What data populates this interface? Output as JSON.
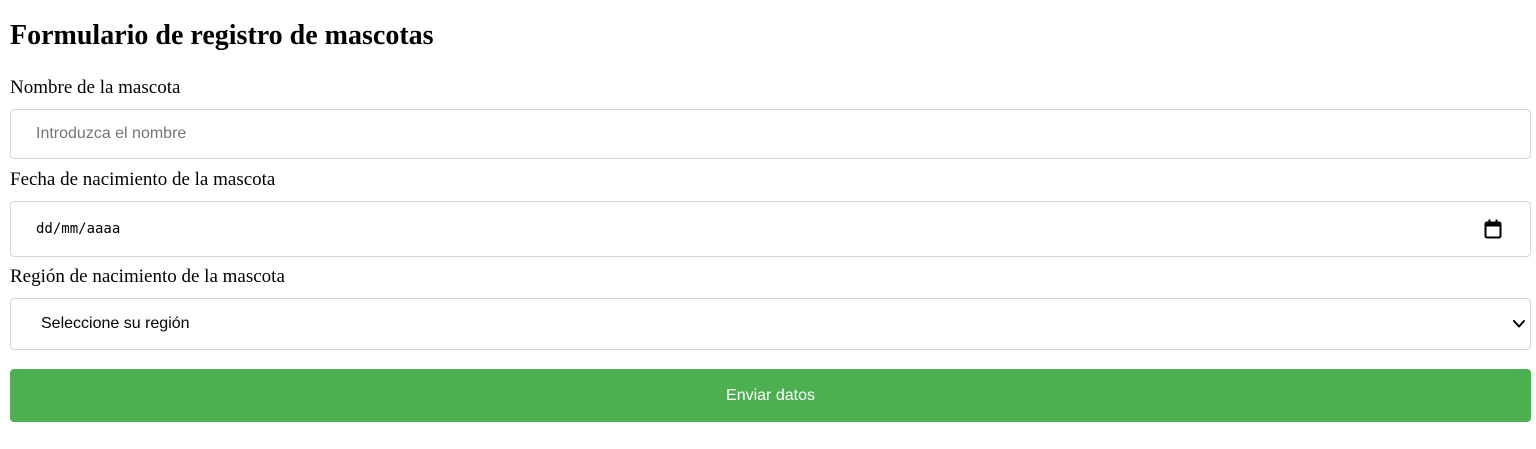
{
  "form": {
    "title": "Formulario de registro de mascotas",
    "name_field": {
      "label": "Nombre de la mascota",
      "value": "",
      "placeholder": "Introduzca el nombre"
    },
    "birthdate_field": {
      "label": "Fecha de nacimiento de la mascota",
      "value": "dd/mm/aaaa",
      "icon": "calendar-icon"
    },
    "region_field": {
      "label": "Región de nacimiento de la mascota",
      "selected": "Seleccione su región",
      "icon": "chevron-down-icon"
    },
    "submit_label": "Enviar datos"
  },
  "colors": {
    "submit_background": "#4caf50",
    "submit_text": "#ffffff",
    "field_border": "#d6d6d6",
    "placeholder_text": "#757575"
  }
}
